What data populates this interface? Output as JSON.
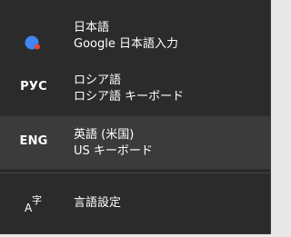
{
  "languages": [
    {
      "icon": "google-ime-icon",
      "name": "日本語",
      "keyboard": "Google 日本語入力",
      "selected": false
    },
    {
      "code": "РУС",
      "name": "ロシア語",
      "keyboard": "ロシア語 キーボード",
      "selected": false
    },
    {
      "code": "ENG",
      "name": "英語 (米国)",
      "keyboard": "US キーボード",
      "selected": true
    }
  ],
  "settings": {
    "icon": "language-settings-icon",
    "label": "言語設定"
  },
  "colors": {
    "background": "#2b2b2b",
    "selected": "#3b3b3b",
    "text": "#ffffff",
    "google_blue": "#4285f4",
    "google_red": "#ea4335"
  }
}
